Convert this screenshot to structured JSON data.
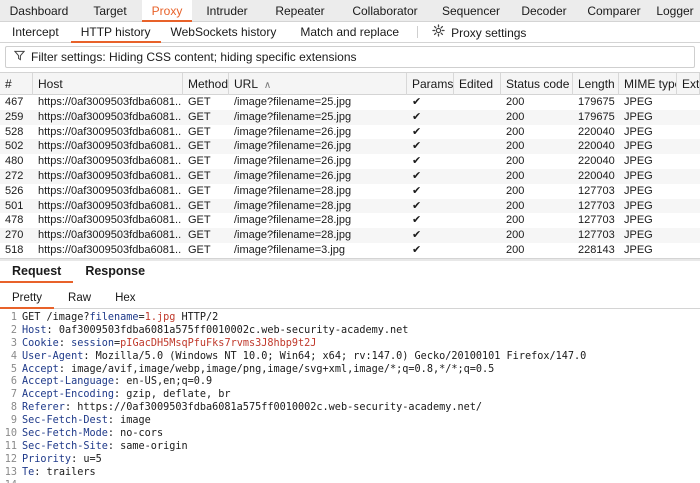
{
  "top_tabs": [
    "Dashboard",
    "Target",
    "Proxy",
    "Intruder",
    "Repeater",
    "Collaborator",
    "Sequencer",
    "Decoder",
    "Comparer",
    "Logger"
  ],
  "top_tabs_active": "Proxy",
  "sub_tabs": [
    "Intercept",
    "HTTP history",
    "WebSockets history",
    "Match and replace",
    "Proxy settings"
  ],
  "sub_tabs_active": "HTTP history",
  "filter": {
    "text": "Filter settings: Hiding CSS content; hiding specific extensions"
  },
  "table": {
    "headers": [
      "#",
      "Host",
      "Method",
      "URL",
      "Params",
      "Edited",
      "Status code",
      "Length",
      "MIME type",
      "Exte"
    ],
    "url_sort_indicator": "∧",
    "rows": [
      [
        "467",
        "https://0af3009503fdba6081...",
        "GET",
        "/image?filename=25.jpg",
        "✔",
        "",
        "200",
        "179675",
        "JPEG"
      ],
      [
        "259",
        "https://0af3009503fdba6081...",
        "GET",
        "/image?filename=25.jpg",
        "✔",
        "",
        "200",
        "179675",
        "JPEG"
      ],
      [
        "528",
        "https://0af3009503fdba6081...",
        "GET",
        "/image?filename=26.jpg",
        "✔",
        "",
        "200",
        "220040",
        "JPEG"
      ],
      [
        "502",
        "https://0af3009503fdba6081...",
        "GET",
        "/image?filename=26.jpg",
        "✔",
        "",
        "200",
        "220040",
        "JPEG"
      ],
      [
        "480",
        "https://0af3009503fdba6081...",
        "GET",
        "/image?filename=26.jpg",
        "✔",
        "",
        "200",
        "220040",
        "JPEG"
      ],
      [
        "272",
        "https://0af3009503fdba6081...",
        "GET",
        "/image?filename=26.jpg",
        "✔",
        "",
        "200",
        "220040",
        "JPEG"
      ],
      [
        "526",
        "https://0af3009503fdba6081...",
        "GET",
        "/image?filename=28.jpg",
        "✔",
        "",
        "200",
        "127703",
        "JPEG"
      ],
      [
        "501",
        "https://0af3009503fdba6081...",
        "GET",
        "/image?filename=28.jpg",
        "✔",
        "",
        "200",
        "127703",
        "JPEG"
      ],
      [
        "478",
        "https://0af3009503fdba6081...",
        "GET",
        "/image?filename=28.jpg",
        "✔",
        "",
        "200",
        "127703",
        "JPEG"
      ],
      [
        "270",
        "https://0af3009503fdba6081...",
        "GET",
        "/image?filename=28.jpg",
        "✔",
        "",
        "200",
        "127703",
        "JPEG"
      ],
      [
        "518",
        "https://0af3009503fdba6081...",
        "GET",
        "/image?filename=3.jpg",
        "✔",
        "",
        "200",
        "228143",
        "JPEG"
      ]
    ]
  },
  "message_tabs": [
    "Request",
    "Response"
  ],
  "message_tabs_active": "Request",
  "view_tabs": [
    "Pretty",
    "Raw",
    "Hex"
  ],
  "view_tabs_active": "Pretty",
  "request_lines": [
    {
      "n": "1",
      "parts": [
        [
          "",
          "GET /image?"
        ],
        [
          "qkey",
          "filename"
        ],
        [
          "",
          "="
        ],
        [
          "qval",
          "1.jpg"
        ],
        [
          "",
          " HTTP/2"
        ]
      ]
    },
    {
      "n": "2",
      "parts": [
        [
          "hname",
          "Host"
        ],
        [
          "",
          ": 0af3009503fdba6081a575ff0010002c.web-security-academy.net"
        ]
      ]
    },
    {
      "n": "3",
      "parts": [
        [
          "hname",
          "Cookie"
        ],
        [
          "",
          ": "
        ],
        [
          "qkey",
          "session"
        ],
        [
          "",
          "="
        ],
        [
          "qval",
          "pIGacDH5MsqPfuFks7rvms3J8hbp9t2J"
        ]
      ]
    },
    {
      "n": "4",
      "parts": [
        [
          "hname",
          "User-Agent"
        ],
        [
          "",
          ": Mozilla/5.0 (Windows NT 10.0; Win64; x64; rv:147.0) Gecko/20100101 Firefox/147.0"
        ]
      ]
    },
    {
      "n": "5",
      "parts": [
        [
          "hname",
          "Accept"
        ],
        [
          "",
          ": image/avif,image/webp,image/png,image/svg+xml,image/*;q=0.8,*/*;q=0.5"
        ]
      ]
    },
    {
      "n": "6",
      "parts": [
        [
          "hname",
          "Accept-Language"
        ],
        [
          "",
          ": en-US,en;q=0.9"
        ]
      ]
    },
    {
      "n": "7",
      "parts": [
        [
          "hname",
          "Accept-Encoding"
        ],
        [
          "",
          ": gzip, deflate, br"
        ]
      ]
    },
    {
      "n": "8",
      "parts": [
        [
          "hname",
          "Referer"
        ],
        [
          "",
          ": https://0af3009503fdba6081a575ff0010002c.web-security-academy.net/"
        ]
      ]
    },
    {
      "n": "9",
      "parts": [
        [
          "hname",
          "Sec-Fetch-Dest"
        ],
        [
          "",
          ": image"
        ]
      ]
    },
    {
      "n": "10",
      "parts": [
        [
          "hname",
          "Sec-Fetch-Mode"
        ],
        [
          "",
          ": no-cors"
        ]
      ]
    },
    {
      "n": "11",
      "parts": [
        [
          "hname",
          "Sec-Fetch-Site"
        ],
        [
          "",
          ": same-origin"
        ]
      ]
    },
    {
      "n": "12",
      "parts": [
        [
          "hname",
          "Priority"
        ],
        [
          "",
          ": u=5"
        ]
      ]
    },
    {
      "n": "13",
      "parts": [
        [
          "hname",
          "Te"
        ],
        [
          "",
          ": trailers"
        ]
      ]
    },
    {
      "n": "14",
      "parts": []
    },
    {
      "n": "15",
      "parts": []
    }
  ],
  "colors": {
    "accent": "#e8622a",
    "header_name": "#1f3a8a",
    "param_value": "#c0392b"
  }
}
